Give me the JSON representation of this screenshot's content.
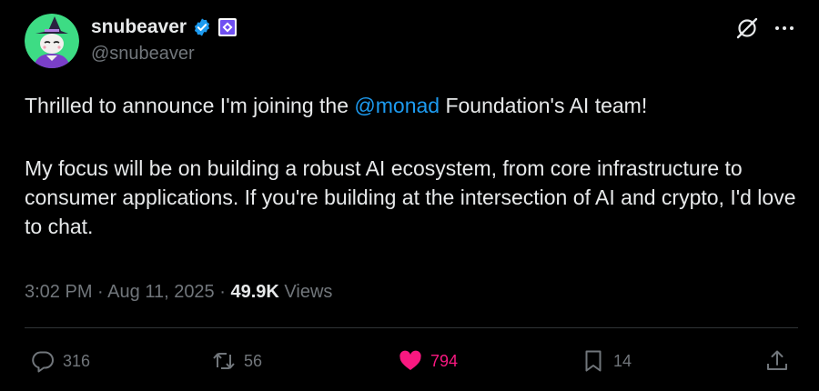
{
  "author": {
    "display_name": "snubeaver",
    "handle": "@snubeaver",
    "verified": true,
    "avatar_icon": "witch-cat-avatar"
  },
  "tweet": {
    "line1_prefix": "Thrilled to announce I'm joining the ",
    "mention": "@monad",
    "line1_suffix": " Foundation's AI team!",
    "paragraph2": "My focus will be on building a robust AI ecosystem, from core infrastructure to consumer applications. If you're building at the intersection of AI and crypto, I'd love to chat."
  },
  "meta": {
    "time": "3:02 PM",
    "separator": "·",
    "date": "Aug 11, 2025",
    "views_count": "49.9K",
    "views_label": "Views"
  },
  "actions": {
    "replies": "316",
    "reposts": "56",
    "likes": "794",
    "bookmarks": "14"
  },
  "colors": {
    "background": "#000000",
    "text": "#e7e9ea",
    "secondary": "#71767b",
    "link": "#1d9bf0",
    "like": "#f91880",
    "verified": "#1d9bf0",
    "divider": "#2f3336"
  }
}
